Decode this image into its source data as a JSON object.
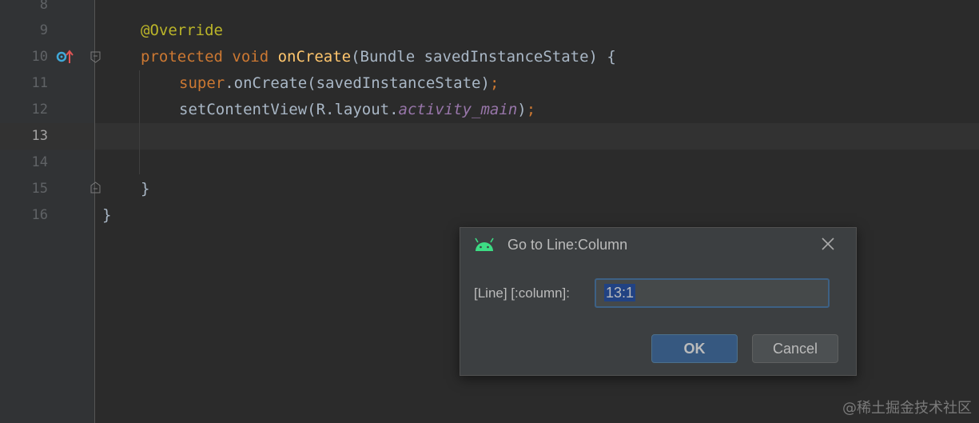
{
  "editor": {
    "current_line": 13,
    "lines": [
      {
        "num": "8",
        "segments": []
      },
      {
        "num": "9",
        "segments": [
          {
            "cls": "annotation",
            "text": "@Override"
          }
        ]
      },
      {
        "num": "10",
        "segments": [
          {
            "cls": "kw",
            "text": "protected "
          },
          {
            "cls": "kw",
            "text": "void "
          },
          {
            "cls": "fn",
            "text": "onCreate"
          },
          {
            "cls": "",
            "text": "(Bundle savedInstanceState) {"
          }
        ]
      },
      {
        "num": "11",
        "segments": [
          {
            "cls": "kw",
            "text": "super"
          },
          {
            "cls": "",
            "text": ".onCreate(savedInstanceState)"
          },
          {
            "cls": "kw",
            "text": ";"
          }
        ]
      },
      {
        "num": "12",
        "segments": [
          {
            "cls": "",
            "text": "setContentView(R.layout."
          },
          {
            "cls": "italic-field",
            "text": "activity_main"
          },
          {
            "cls": "",
            "text": ")"
          },
          {
            "cls": "kw",
            "text": ";"
          }
        ]
      },
      {
        "num": "13",
        "segments": []
      },
      {
        "num": "14",
        "segments": []
      },
      {
        "num": "15",
        "segments": [
          {
            "cls": "",
            "text": "}"
          }
        ]
      },
      {
        "num": "16",
        "segments": [
          {
            "cls": "",
            "text": "}"
          }
        ]
      }
    ]
  },
  "dialog": {
    "title": "Go to Line:Column",
    "field_label": "[Line] [:column]:",
    "field_value": "13:1",
    "ok_label": "OK",
    "cancel_label": "Cancel"
  },
  "watermark": "@稀土掘金技术社区",
  "colors": {
    "accent": "#365880",
    "android_green": "#3ddc84"
  }
}
